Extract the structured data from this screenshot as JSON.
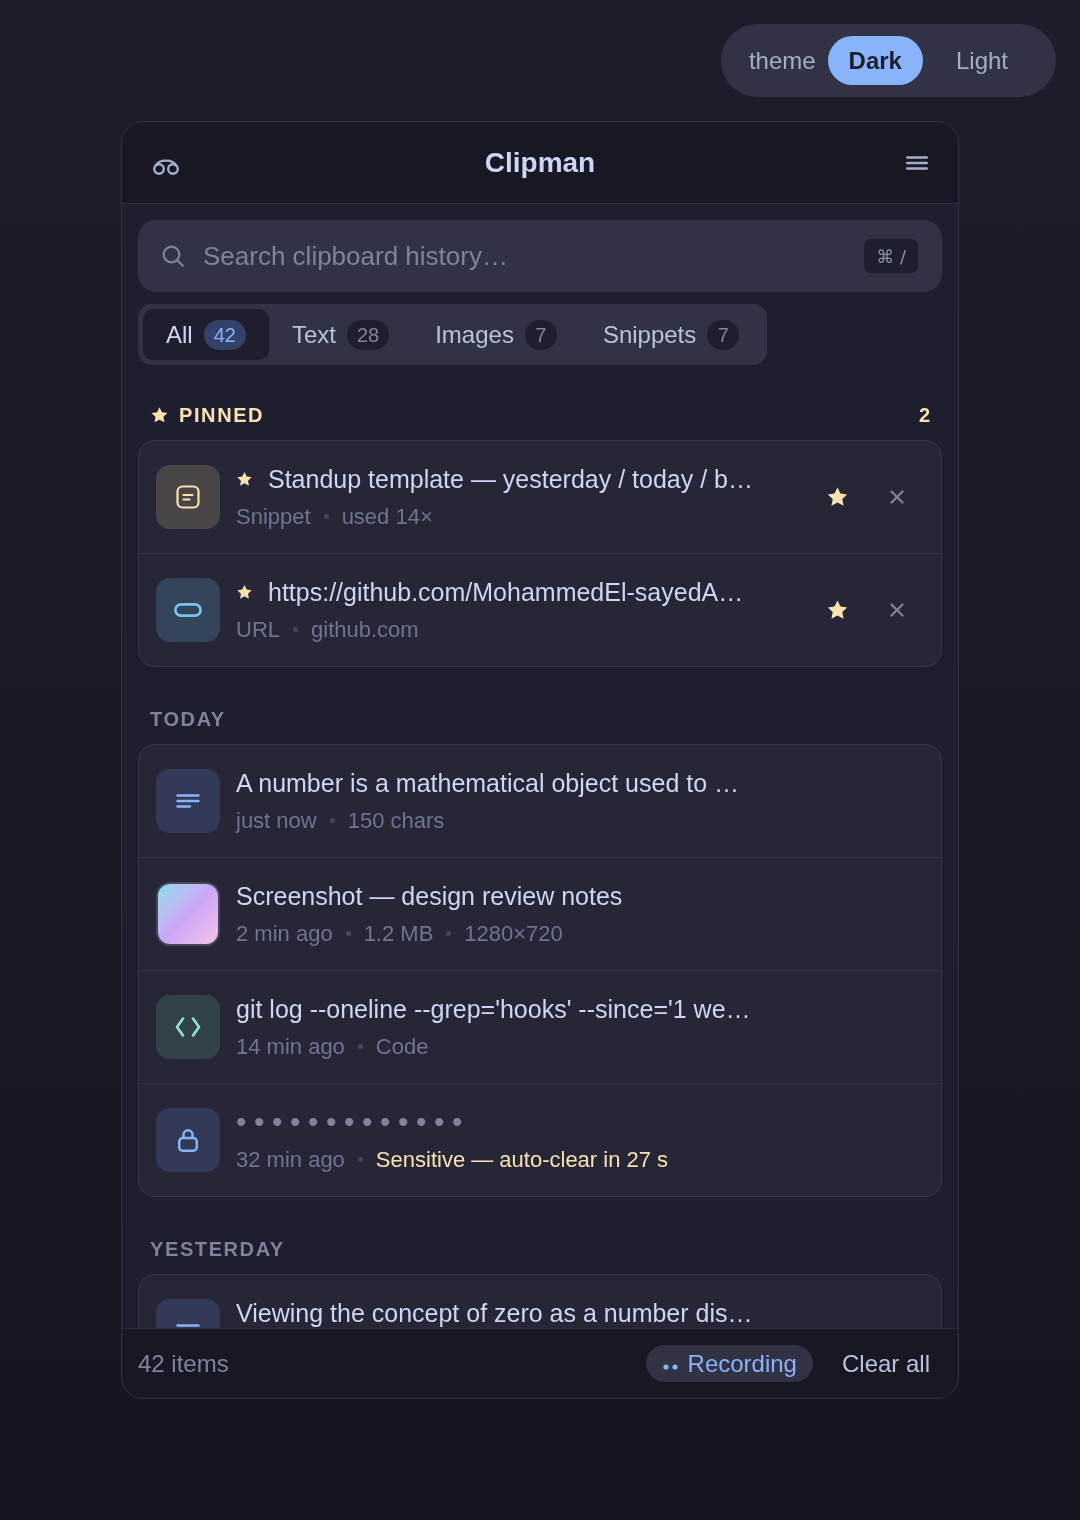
{
  "theme_switch": {
    "label": "theme",
    "options": [
      {
        "label": "Dark",
        "selected": true
      },
      {
        "label": "Light",
        "selected": false
      }
    ]
  },
  "window": {
    "title": "Clipman"
  },
  "search": {
    "placeholder": "Search clipboard history…",
    "shortcut": "⌘ /"
  },
  "tabs": [
    {
      "label": "All",
      "count": "42",
      "selected": true
    },
    {
      "label": "Text",
      "count": "28",
      "selected": false
    },
    {
      "label": "Images",
      "count": "7",
      "selected": false
    },
    {
      "label": "Snippets",
      "count": "7",
      "selected": false
    }
  ],
  "sections": [
    {
      "kind": "pinned",
      "title": "PINNED",
      "count": "2",
      "items": [
        {
          "kind": "snippet",
          "title": "Standup template — yesterday / today / b…",
          "pinned": true,
          "meta": [
            "Snippet",
            "used 14×"
          ]
        },
        {
          "kind": "url",
          "title": "https://github.com/MohammedEl-sayedA…",
          "pinned": true,
          "meta": [
            "URL",
            "github.com"
          ]
        }
      ]
    },
    {
      "kind": "plain",
      "title": "TODAY",
      "items": [
        {
          "kind": "text",
          "title": "A number is a mathematical object used to …",
          "pinned": false,
          "meta": [
            "just now",
            "150 chars"
          ]
        },
        {
          "kind": "image",
          "title": "Screenshot — design review notes",
          "pinned": false,
          "meta": [
            "2 min ago",
            "1.2 MB",
            "1280×720"
          ]
        },
        {
          "kind": "code",
          "title": "git log --oneline --grep='hooks' --since='1 we…",
          "pinned": false,
          "meta": [
            "14 min ago",
            "Code"
          ]
        },
        {
          "kind": "secret",
          "title": "•••••••••••••",
          "pinned": false,
          "meta": [
            "32 min ago"
          ],
          "alert": "Sensitive — auto-clear in 27 s"
        }
      ]
    },
    {
      "kind": "plain",
      "title": "YESTERDAY",
      "items": [
        {
          "kind": "text",
          "title": "Viewing the concept of zero as a number dis…",
          "pinned": false
        }
      ]
    }
  ],
  "status_bar": {
    "count": "42 items",
    "recording": "Recording",
    "clear": "Clear all"
  }
}
